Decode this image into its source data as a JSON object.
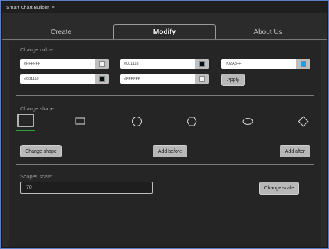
{
  "window": {
    "title": "Smart Chart Builder",
    "menu_glyph": "≡"
  },
  "tabs": [
    {
      "label": "Create",
      "active": false
    },
    {
      "label": "Modify",
      "active": true
    },
    {
      "label": "About Us",
      "active": false
    }
  ],
  "colors": {
    "label": "Change colors:",
    "fields": [
      {
        "value": "#FFFFFF",
        "swatch": "#f2f2f2"
      },
      {
        "value": "#001118",
        "swatch": "#001118"
      },
      {
        "value": "#02A8FF",
        "swatch": "#02a8ff"
      },
      {
        "value": "#001118",
        "swatch": "#001118"
      },
      {
        "value": "#FFFFFF",
        "swatch": "#f2f2f2"
      }
    ],
    "apply_label": "Apply"
  },
  "shape": {
    "label": "Change shape:",
    "options": [
      "square",
      "rectangle",
      "circle",
      "hexagon",
      "ellipse",
      "diamond"
    ],
    "selected": "square",
    "change_label": "Change shape",
    "add_before_label": "Add before",
    "add_after_label": "Add after",
    "selected_underline_color": "#2e9e3a"
  },
  "scale": {
    "label": "Shapes scale:",
    "value": "70",
    "change_label": "Change scale"
  }
}
